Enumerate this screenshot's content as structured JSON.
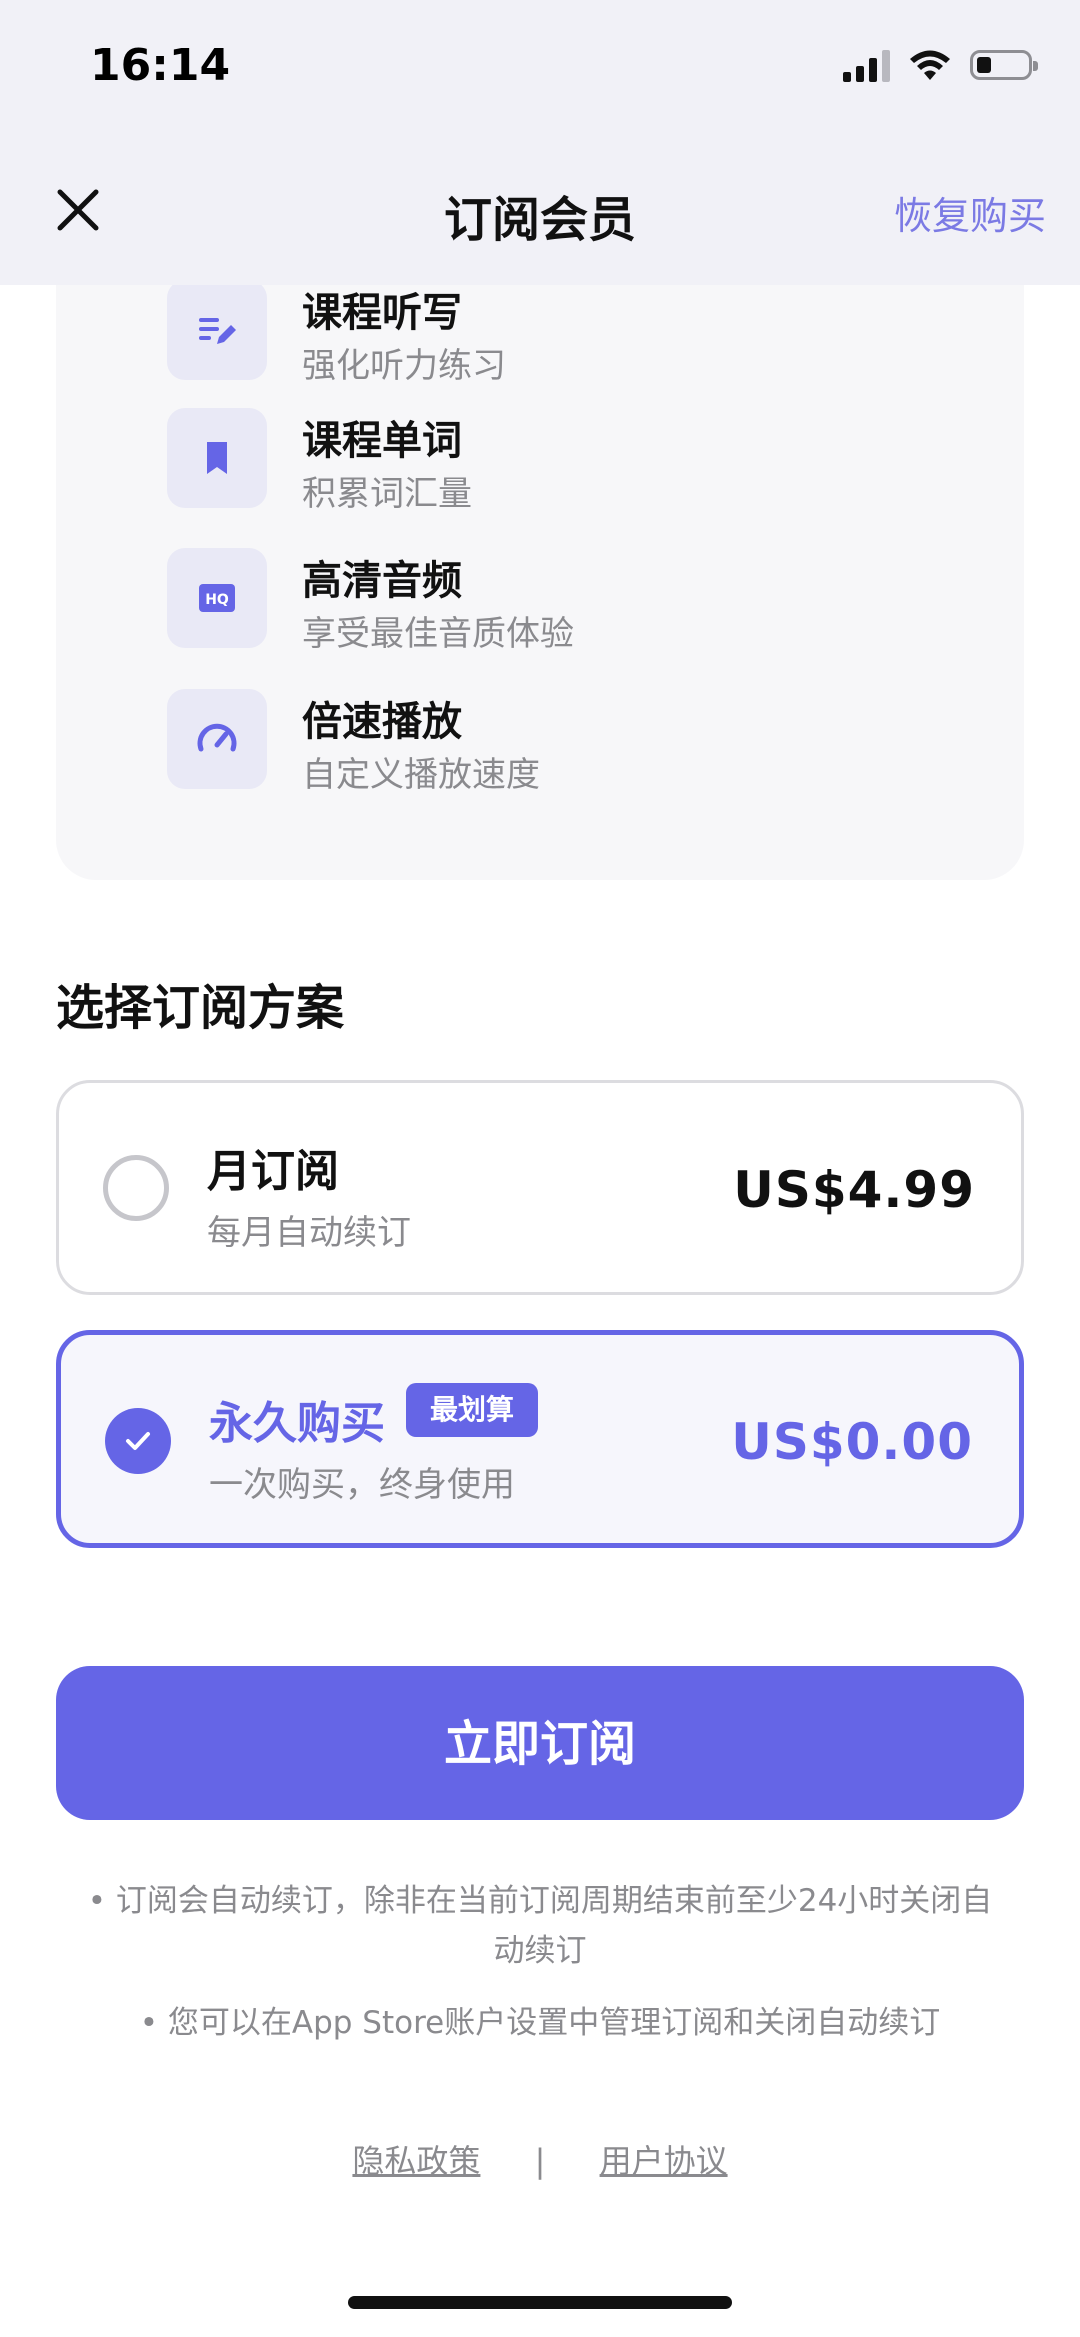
{
  "status_bar": {
    "time": "16:14"
  },
  "nav": {
    "title": "订阅会员",
    "restore": "恢复购买"
  },
  "features": [
    {
      "title": "课程听写",
      "subtitle": "强化听力练习",
      "icon": "edit-list-icon"
    },
    {
      "title": "课程单词",
      "subtitle": "积累词汇量",
      "icon": "bookmark-icon"
    },
    {
      "title": "高清音频",
      "subtitle": "享受最佳音质体验",
      "icon": "hq-icon"
    },
    {
      "title": "倍速播放",
      "subtitle": "自定义播放速度",
      "icon": "speedometer-icon"
    }
  ],
  "plans": {
    "heading": "选择订阅方案",
    "monthly": {
      "name": "月订阅",
      "subtitle": "每月自动续订",
      "price": "US$4.99",
      "selected": false
    },
    "lifetime": {
      "name": "永久购买",
      "badge": "最划算",
      "subtitle": "一次购买，终身使用",
      "price": "US$0.00",
      "selected": true
    }
  },
  "cta": {
    "label": "立即订阅"
  },
  "notes": [
    "• 订阅会自动续订，除非在当前订阅周期结束前至少24小时关闭自动续订",
    "• 您可以在App Store账户设置中管理订阅和关闭自动续订"
  ],
  "links": {
    "privacy": "隐私政策",
    "separator": "|",
    "terms": "用户协议"
  },
  "colors": {
    "accent": "#6565e6",
    "restore_text": "#7b7ae4",
    "nav_bg": "#f1f1f7"
  }
}
